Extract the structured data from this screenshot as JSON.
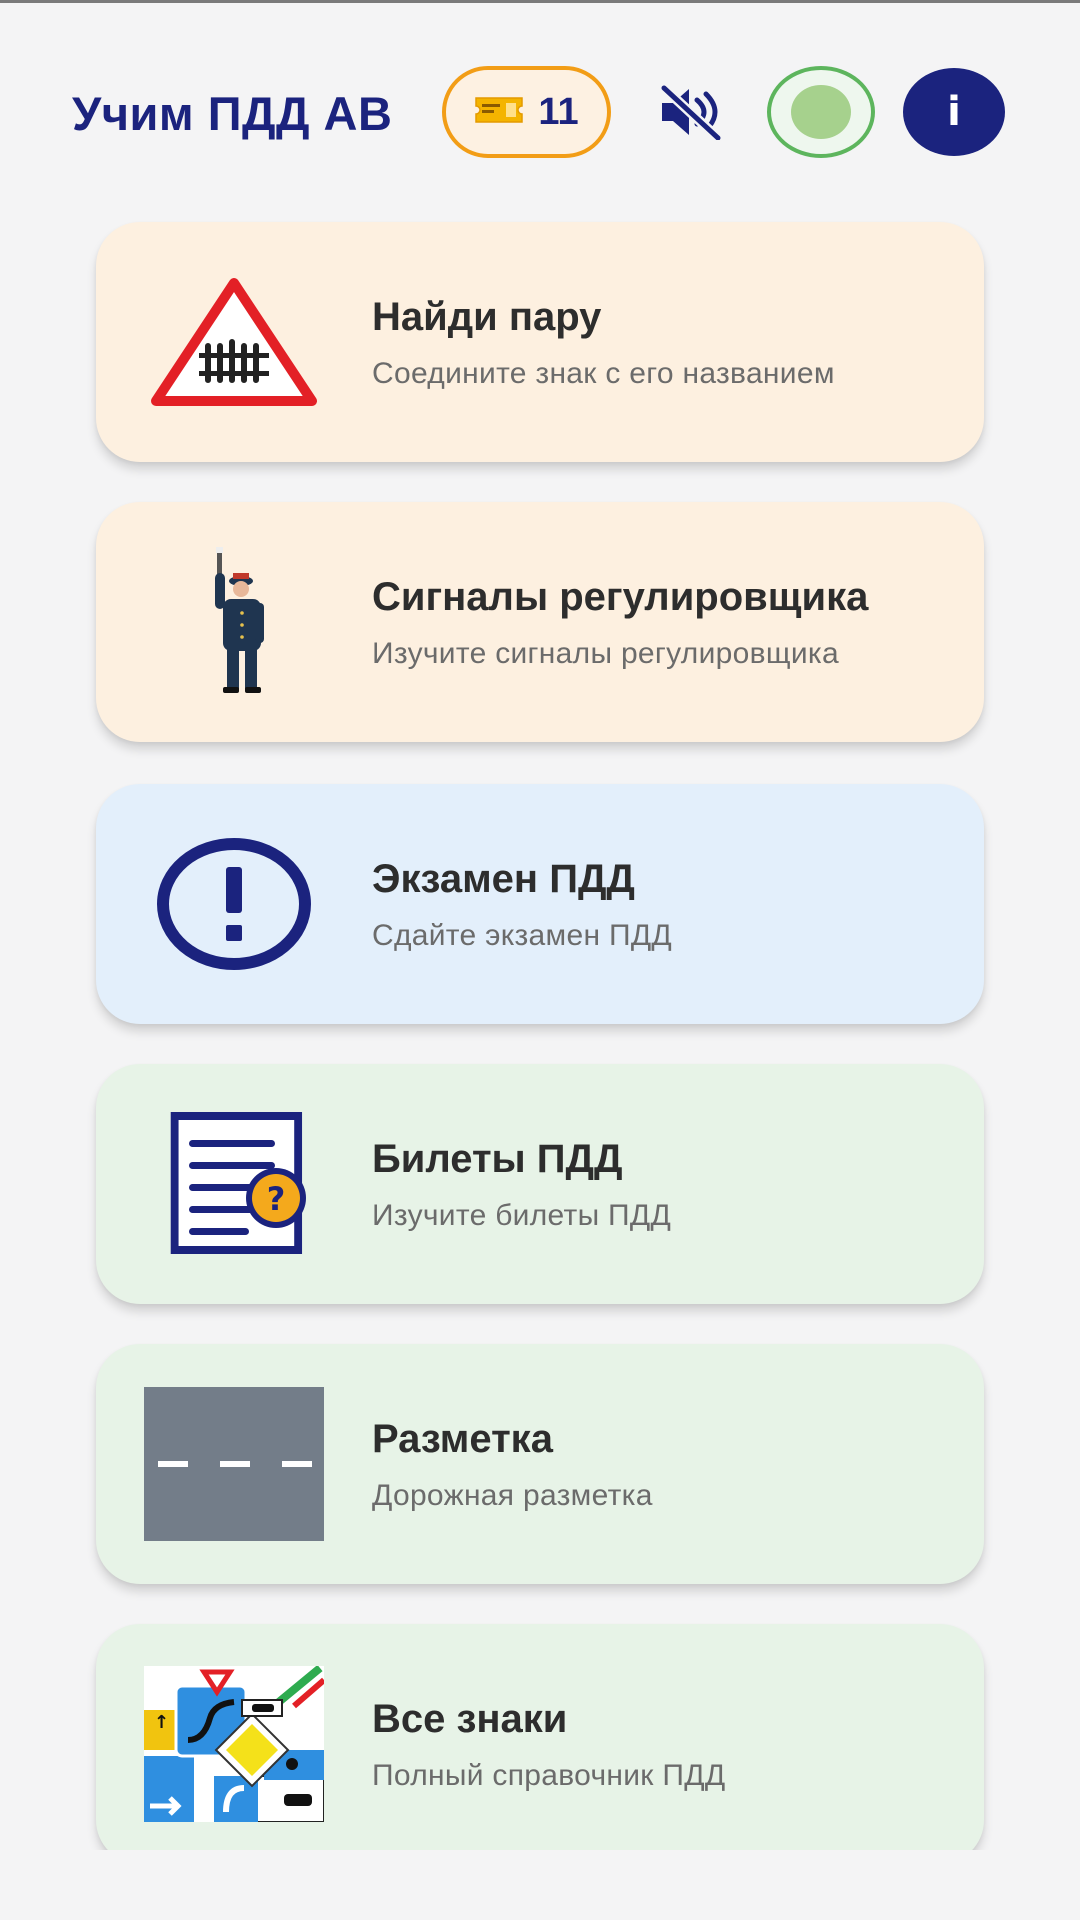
{
  "header": {
    "title": "Учим ПДД АВ",
    "tickets": {
      "icon": "ticket-icon",
      "count": "11"
    },
    "sound": {
      "icon": "volume-mute-icon",
      "state": "muted"
    },
    "status": {
      "icon": "status-light-icon",
      "color": "#a6d18d"
    },
    "info": {
      "icon": "info-icon",
      "label": "i"
    }
  },
  "colors": {
    "brand": "#1b237e",
    "badge_border": "#f29d16",
    "status_border": "#5db55d",
    "card_peach": "#fdf0e0",
    "card_blue": "#e3effb",
    "card_green": "#e7f3e7"
  },
  "menu": [
    {
      "title": "Найди пару",
      "subtitle": "Соедините знак с его названием",
      "icon": "railway-crossing-sign-icon"
    },
    {
      "title": "Сигналы регулировщика",
      "subtitle": "Изучите сигналы регулировщика",
      "icon": "traffic-officer-icon"
    },
    {
      "title": "Экзамен ПДД",
      "subtitle": "Сдайте экзамен ПДД",
      "icon": "exclamation-circle-icon"
    },
    {
      "title": "Билеты ПДД",
      "subtitle": "Изучите билеты ПДД",
      "icon": "question-document-icon"
    },
    {
      "title": "Разметка",
      "subtitle": "Дорожная разметка",
      "icon": "road-marking-icon"
    },
    {
      "title": "Все знаки",
      "subtitle": "Полный справочник ПДД",
      "icon": "road-signs-collage-icon"
    }
  ]
}
